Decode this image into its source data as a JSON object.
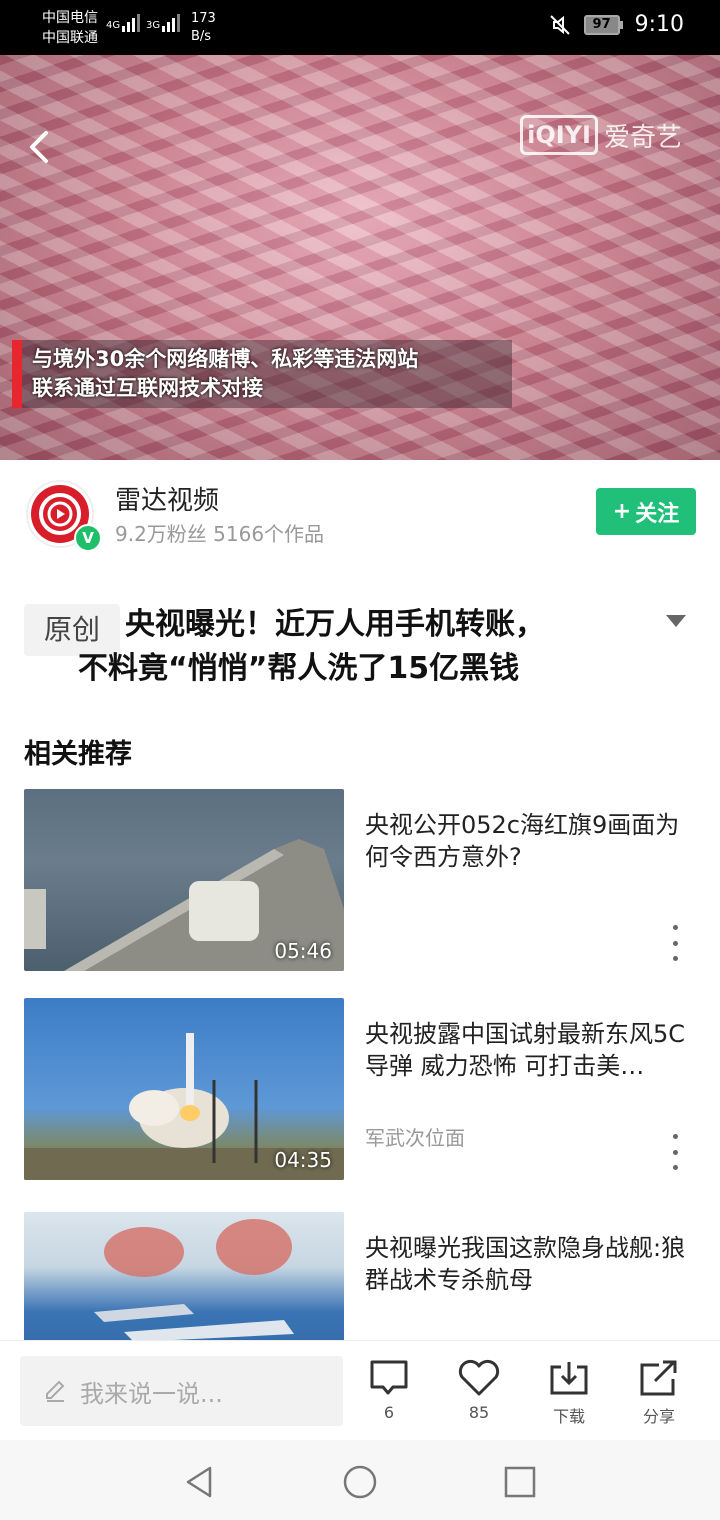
{
  "status_bar": {
    "carrier1": "中国电信",
    "carrier2": "中国联通",
    "net1": "4G",
    "net2": "3G",
    "speed_value": "173",
    "speed_unit": "B/s",
    "battery": "97",
    "time": "9:10"
  },
  "video": {
    "caption_line1": "与境外30余个网络赌博、私彩等违法网站",
    "caption_line2": "联系通过互联网技术对接",
    "watermark_logo": "iQIYI",
    "watermark_text": "爱奇艺"
  },
  "author": {
    "name": "雷达视频",
    "stats": "9.2万粉丝 5166个作品",
    "verified_badge": "V",
    "follow_icon": "+",
    "follow_label": "关注"
  },
  "article": {
    "tag": "原创",
    "title_line1": "央视曝光！近万人用手机转账，",
    "title_line2": "不料竟“悄悄”帮人洗了15亿黑钱"
  },
  "related": {
    "heading": "相关推荐",
    "items": [
      {
        "title": "央视公开052c海红旗9画面为何令西方意外?",
        "source": "",
        "duration": "05:46"
      },
      {
        "title": "央视披露中国试射最新东风5C导弹 威力恐怖 可打击美…",
        "source": "军武次位面",
        "duration": "04:35"
      },
      {
        "title": "央视曝光我国这款隐身战舰:狼群战术专杀航母",
        "source": "",
        "duration": ""
      }
    ]
  },
  "bottom_bar": {
    "comment_placeholder": "我来说一说...",
    "comment_count": "6",
    "like_count": "85",
    "download_label": "下载",
    "share_label": "分享"
  },
  "colors": {
    "accent_green": "#21c07a",
    "brand_red": "#d81e2a"
  }
}
